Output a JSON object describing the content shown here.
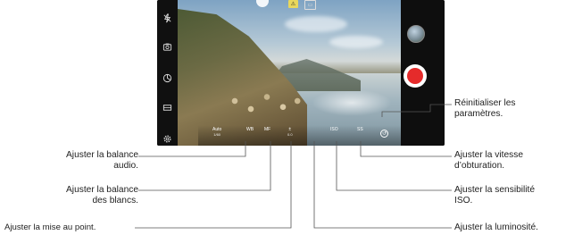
{
  "camera_ui": {
    "top_indicators": [
      "⚠",
      "▭"
    ],
    "controls": [
      {
        "name": "audio-balance-control",
        "label": "Auto",
        "value": "1/60"
      },
      {
        "name": "white-balance-control",
        "label": "WB",
        "value": ""
      },
      {
        "name": "focus-control",
        "label": "MF",
        "value": ""
      },
      {
        "name": "brightness-control",
        "label": "±",
        "value": "0.0"
      },
      {
        "name": "iso-control",
        "label": "ISO",
        "value": ""
      },
      {
        "name": "shutter-speed-control",
        "label": "SS",
        "value": ""
      }
    ],
    "left_rail_icons": [
      "flash-off-icon",
      "switch-camera-icon",
      "mode-icon",
      "aspect-ratio-icon",
      "settings-icon"
    ],
    "colors": {
      "record": "#e52b2b",
      "rail": "#101010"
    }
  },
  "callouts": {
    "left": [
      {
        "text": "Ajuster la balance\naudio."
      },
      {
        "text": "Ajuster la balance\ndes blancs."
      },
      {
        "text": "Ajuster la mise au point."
      }
    ],
    "right": [
      {
        "text": "Réinitialiser les\nparamètres."
      },
      {
        "text": "Ajuster la vitesse\nd’obturation."
      },
      {
        "text": "Ajuster la sensibilité\nISO."
      },
      {
        "text": "Ajuster la luminosité."
      }
    ]
  }
}
